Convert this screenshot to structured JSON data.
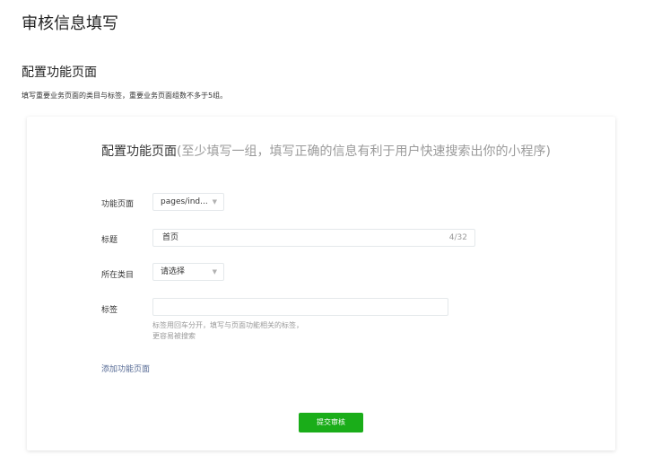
{
  "page": {
    "title": "审核信息填写"
  },
  "section": {
    "title": "配置功能页面",
    "description": "填写重要业务页面的类目与标签，重要业务页面组数不多于5组。"
  },
  "form": {
    "heading": "配置功能页面",
    "heading_hint": "(至少填写一组，填写正确的信息有利于用户快速搜索出你的小程序)",
    "page_label": "功能页面",
    "page_value": "pages/ind...",
    "title_label": "标题",
    "title_value": "首页",
    "title_counter": "4/32",
    "category_label": "所在类目",
    "category_value": "请选择",
    "tags_label": "标签",
    "tags_value": "",
    "tags_tip_line1": "标签用回车分开，填写与页面功能相关的标签，",
    "tags_tip_line2": "更容易被搜索",
    "add_page_link": "添加功能页面",
    "submit_label": "提交审核",
    "caret_icon": "chevron-down-icon"
  },
  "colors": {
    "accent_green": "#1aad19",
    "link_blue": "#576b95",
    "hint_gray": "#9a9a9a"
  }
}
